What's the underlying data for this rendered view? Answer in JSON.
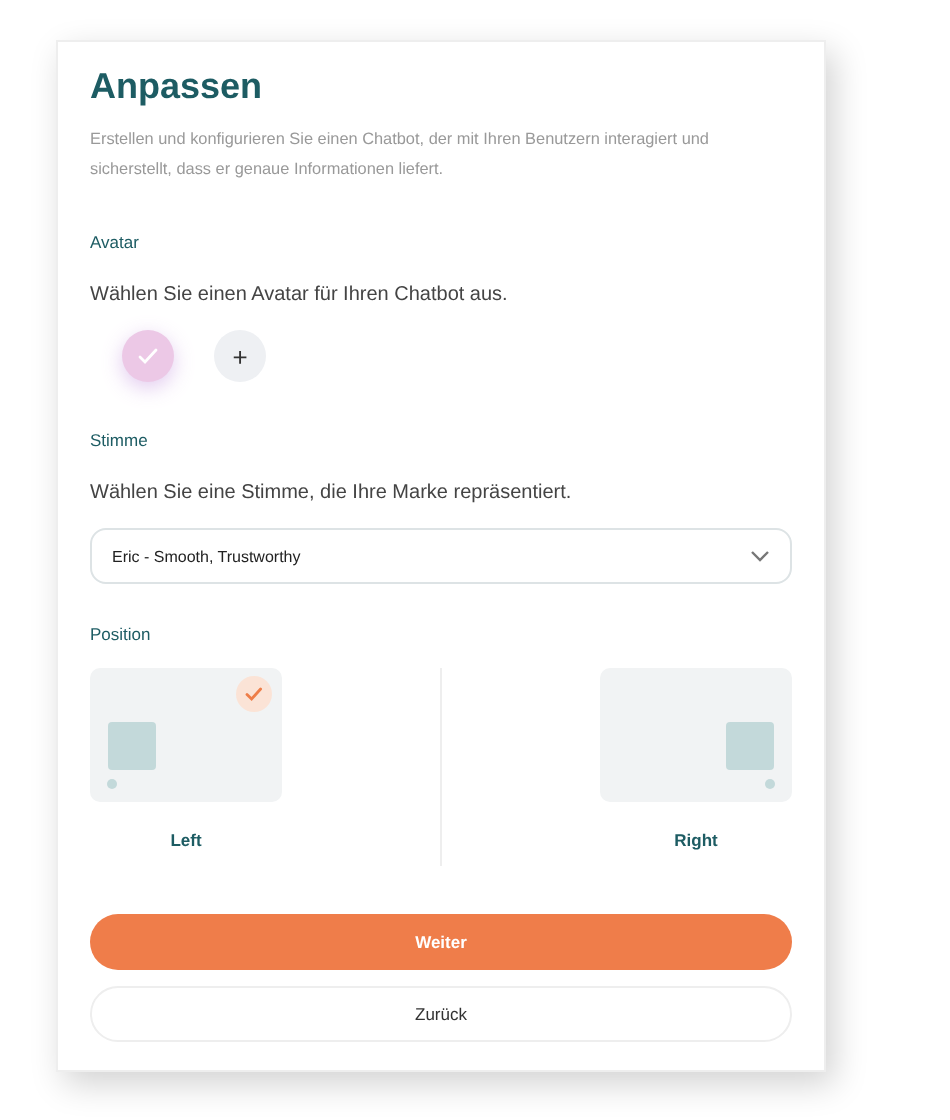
{
  "title": "Anpassen",
  "description": "Erstellen und konfigurieren Sie einen Chatbot, der mit Ihren Benutzern interagiert und sicherstellt, dass er genaue Informationen liefert.",
  "avatar": {
    "heading": "Avatar",
    "prompt": "Wählen Sie einen Avatar für Ihren Chatbot aus.",
    "options": [
      {
        "selected": true
      }
    ],
    "add_label": "+"
  },
  "voice": {
    "heading": "Stimme",
    "prompt": "Wählen Sie eine Stimme, die Ihre Marke repräsentiert.",
    "value": "Eric - Smooth, Trustworthy"
  },
  "position": {
    "heading": "Position",
    "options": [
      {
        "label": "Left",
        "kind": "left",
        "selected": true
      },
      {
        "label": "Right",
        "kind": "right",
        "selected": false
      }
    ]
  },
  "buttons": [
    {
      "label": "Weiter",
      "kind": "primary"
    },
    {
      "label": "Zurück",
      "kind": "secondary"
    }
  ]
}
